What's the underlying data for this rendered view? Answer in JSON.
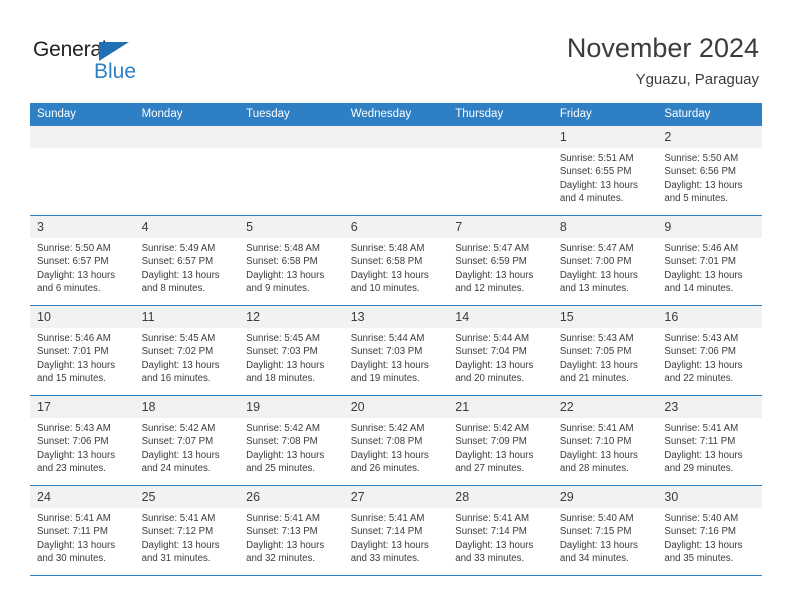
{
  "brand": {
    "name_part1": "General",
    "name_part2": "Blue",
    "color_dark": "#231f20",
    "color_blue": "#2f7fc4"
  },
  "header": {
    "title": "November 2024",
    "location": "Yguazu, Paraguay"
  },
  "calendar": {
    "accent_color": "#2f7fc4",
    "daynum_bg": "#f2f2f2",
    "weekdays": [
      "Sunday",
      "Monday",
      "Tuesday",
      "Wednesday",
      "Thursday",
      "Friday",
      "Saturday"
    ],
    "weeks": [
      [
        {
          "day": "",
          "empty": true
        },
        {
          "day": "",
          "empty": true
        },
        {
          "day": "",
          "empty": true
        },
        {
          "day": "",
          "empty": true
        },
        {
          "day": "",
          "empty": true
        },
        {
          "day": "1",
          "sunrise": "Sunrise: 5:51 AM",
          "sunset": "Sunset: 6:55 PM",
          "daylight_line1": "Daylight: 13 hours",
          "daylight_line2": "and 4 minutes."
        },
        {
          "day": "2",
          "sunrise": "Sunrise: 5:50 AM",
          "sunset": "Sunset: 6:56 PM",
          "daylight_line1": "Daylight: 13 hours",
          "daylight_line2": "and 5 minutes."
        }
      ],
      [
        {
          "day": "3",
          "sunrise": "Sunrise: 5:50 AM",
          "sunset": "Sunset: 6:57 PM",
          "daylight_line1": "Daylight: 13 hours",
          "daylight_line2": "and 6 minutes."
        },
        {
          "day": "4",
          "sunrise": "Sunrise: 5:49 AM",
          "sunset": "Sunset: 6:57 PM",
          "daylight_line1": "Daylight: 13 hours",
          "daylight_line2": "and 8 minutes."
        },
        {
          "day": "5",
          "sunrise": "Sunrise: 5:48 AM",
          "sunset": "Sunset: 6:58 PM",
          "daylight_line1": "Daylight: 13 hours",
          "daylight_line2": "and 9 minutes."
        },
        {
          "day": "6",
          "sunrise": "Sunrise: 5:48 AM",
          "sunset": "Sunset: 6:58 PM",
          "daylight_line1": "Daylight: 13 hours",
          "daylight_line2": "and 10 minutes."
        },
        {
          "day": "7",
          "sunrise": "Sunrise: 5:47 AM",
          "sunset": "Sunset: 6:59 PM",
          "daylight_line1": "Daylight: 13 hours",
          "daylight_line2": "and 12 minutes."
        },
        {
          "day": "8",
          "sunrise": "Sunrise: 5:47 AM",
          "sunset": "Sunset: 7:00 PM",
          "daylight_line1": "Daylight: 13 hours",
          "daylight_line2": "and 13 minutes."
        },
        {
          "day": "9",
          "sunrise": "Sunrise: 5:46 AM",
          "sunset": "Sunset: 7:01 PM",
          "daylight_line1": "Daylight: 13 hours",
          "daylight_line2": "and 14 minutes."
        }
      ],
      [
        {
          "day": "10",
          "sunrise": "Sunrise: 5:46 AM",
          "sunset": "Sunset: 7:01 PM",
          "daylight_line1": "Daylight: 13 hours",
          "daylight_line2": "and 15 minutes."
        },
        {
          "day": "11",
          "sunrise": "Sunrise: 5:45 AM",
          "sunset": "Sunset: 7:02 PM",
          "daylight_line1": "Daylight: 13 hours",
          "daylight_line2": "and 16 minutes."
        },
        {
          "day": "12",
          "sunrise": "Sunrise: 5:45 AM",
          "sunset": "Sunset: 7:03 PM",
          "daylight_line1": "Daylight: 13 hours",
          "daylight_line2": "and 18 minutes."
        },
        {
          "day": "13",
          "sunrise": "Sunrise: 5:44 AM",
          "sunset": "Sunset: 7:03 PM",
          "daylight_line1": "Daylight: 13 hours",
          "daylight_line2": "and 19 minutes."
        },
        {
          "day": "14",
          "sunrise": "Sunrise: 5:44 AM",
          "sunset": "Sunset: 7:04 PM",
          "daylight_line1": "Daylight: 13 hours",
          "daylight_line2": "and 20 minutes."
        },
        {
          "day": "15",
          "sunrise": "Sunrise: 5:43 AM",
          "sunset": "Sunset: 7:05 PM",
          "daylight_line1": "Daylight: 13 hours",
          "daylight_line2": "and 21 minutes."
        },
        {
          "day": "16",
          "sunrise": "Sunrise: 5:43 AM",
          "sunset": "Sunset: 7:06 PM",
          "daylight_line1": "Daylight: 13 hours",
          "daylight_line2": "and 22 minutes."
        }
      ],
      [
        {
          "day": "17",
          "sunrise": "Sunrise: 5:43 AM",
          "sunset": "Sunset: 7:06 PM",
          "daylight_line1": "Daylight: 13 hours",
          "daylight_line2": "and 23 minutes."
        },
        {
          "day": "18",
          "sunrise": "Sunrise: 5:42 AM",
          "sunset": "Sunset: 7:07 PM",
          "daylight_line1": "Daylight: 13 hours",
          "daylight_line2": "and 24 minutes."
        },
        {
          "day": "19",
          "sunrise": "Sunrise: 5:42 AM",
          "sunset": "Sunset: 7:08 PM",
          "daylight_line1": "Daylight: 13 hours",
          "daylight_line2": "and 25 minutes."
        },
        {
          "day": "20",
          "sunrise": "Sunrise: 5:42 AM",
          "sunset": "Sunset: 7:08 PM",
          "daylight_line1": "Daylight: 13 hours",
          "daylight_line2": "and 26 minutes."
        },
        {
          "day": "21",
          "sunrise": "Sunrise: 5:42 AM",
          "sunset": "Sunset: 7:09 PM",
          "daylight_line1": "Daylight: 13 hours",
          "daylight_line2": "and 27 minutes."
        },
        {
          "day": "22",
          "sunrise": "Sunrise: 5:41 AM",
          "sunset": "Sunset: 7:10 PM",
          "daylight_line1": "Daylight: 13 hours",
          "daylight_line2": "and 28 minutes."
        },
        {
          "day": "23",
          "sunrise": "Sunrise: 5:41 AM",
          "sunset": "Sunset: 7:11 PM",
          "daylight_line1": "Daylight: 13 hours",
          "daylight_line2": "and 29 minutes."
        }
      ],
      [
        {
          "day": "24",
          "sunrise": "Sunrise: 5:41 AM",
          "sunset": "Sunset: 7:11 PM",
          "daylight_line1": "Daylight: 13 hours",
          "daylight_line2": "and 30 minutes."
        },
        {
          "day": "25",
          "sunrise": "Sunrise: 5:41 AM",
          "sunset": "Sunset: 7:12 PM",
          "daylight_line1": "Daylight: 13 hours",
          "daylight_line2": "and 31 minutes."
        },
        {
          "day": "26",
          "sunrise": "Sunrise: 5:41 AM",
          "sunset": "Sunset: 7:13 PM",
          "daylight_line1": "Daylight: 13 hours",
          "daylight_line2": "and 32 minutes."
        },
        {
          "day": "27",
          "sunrise": "Sunrise: 5:41 AM",
          "sunset": "Sunset: 7:14 PM",
          "daylight_line1": "Daylight: 13 hours",
          "daylight_line2": "and 33 minutes."
        },
        {
          "day": "28",
          "sunrise": "Sunrise: 5:41 AM",
          "sunset": "Sunset: 7:14 PM",
          "daylight_line1": "Daylight: 13 hours",
          "daylight_line2": "and 33 minutes."
        },
        {
          "day": "29",
          "sunrise": "Sunrise: 5:40 AM",
          "sunset": "Sunset: 7:15 PM",
          "daylight_line1": "Daylight: 13 hours",
          "daylight_line2": "and 34 minutes."
        },
        {
          "day": "30",
          "sunrise": "Sunrise: 5:40 AM",
          "sunset": "Sunset: 7:16 PM",
          "daylight_line1": "Daylight: 13 hours",
          "daylight_line2": "and 35 minutes."
        }
      ]
    ]
  }
}
